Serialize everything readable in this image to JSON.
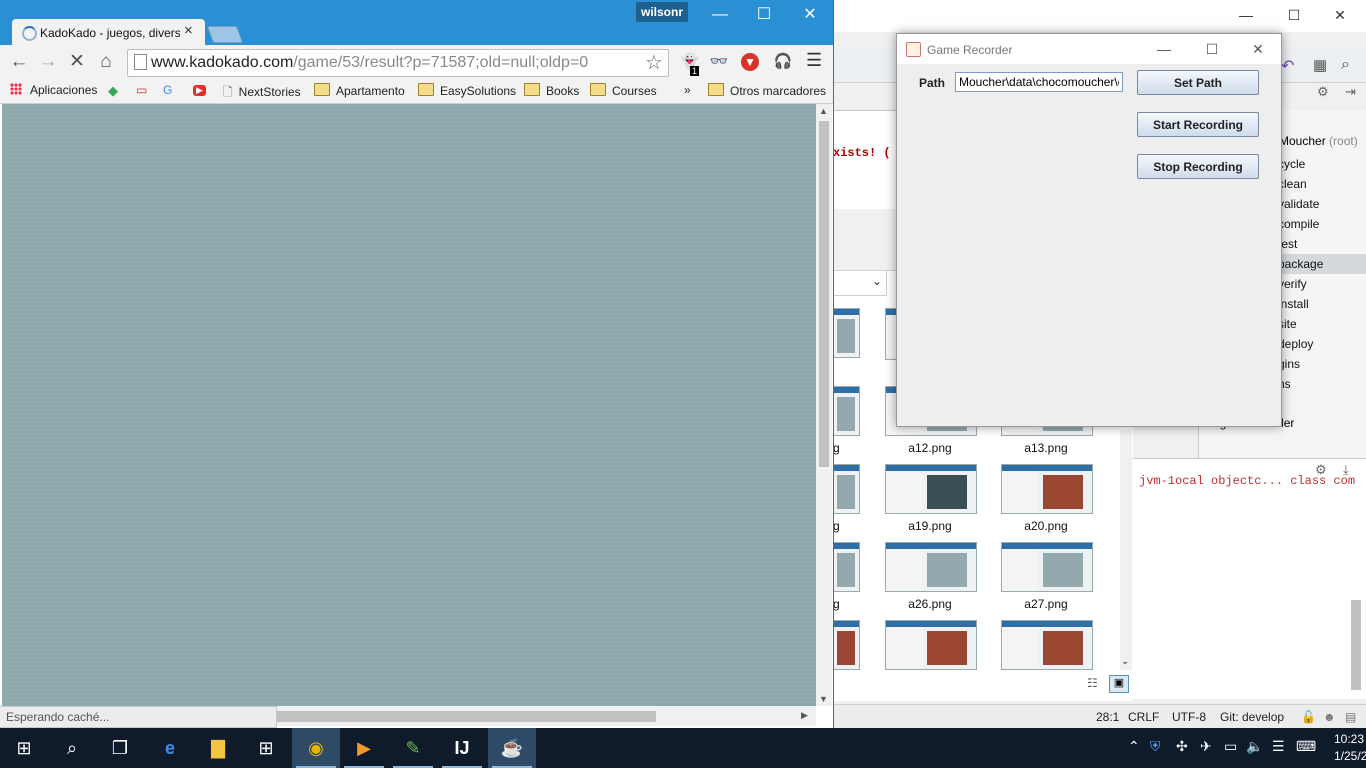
{
  "browser": {
    "user_badge": "wilsonr",
    "tab_title": "KadoKado - juegos, divers",
    "tab_close": "×",
    "url_host": "www.kadokado.com",
    "url_path": "/game/53/result?p=71587;old=null;oldp=0",
    "status_text": "Esperando caché...",
    "bookmarks": {
      "apps": "Aplicaciones",
      "items": [
        "NextStories",
        "Apartamento",
        "EasySolutions",
        "Books",
        "Courses"
      ],
      "overflow": "»",
      "other": "Otros marcadores"
    },
    "icons": {
      "back": "back-arrow-icon",
      "forward": "forward-arrow-icon",
      "stop": "stop-icon",
      "home": "home-icon",
      "star": "star-icon",
      "menu": "hamburger-menu-icon"
    },
    "extension_badge": "1",
    "page_bg_color": "#8ca8ab"
  },
  "recorder": {
    "title": "Game Recorder",
    "path_label": "Path",
    "path_value": "Moucher\\data\\chocomoucher\\e",
    "set_path": "Set Path",
    "start_recording": "Start Recording",
    "stop_recording": "Stop Recording"
  },
  "ide": {
    "console_text": "xists! (",
    "console_bottom_text": "jvm-1ocal objectc... class com",
    "maven_root": "Moucher",
    "maven_root_suffix": "(root)",
    "maven_items": [
      "cycle",
      "clean",
      "validate",
      "compile",
      "test",
      "package",
      "verify",
      "install",
      "site",
      "deploy",
      "gins",
      "ns"
    ],
    "maven_selected": "package",
    "module": "gamerecorder",
    "status": {
      "position": "28:1",
      "line_sep": "CRLF",
      "encoding": "UTF-8",
      "git": "Git: develop"
    }
  },
  "explorer": {
    "files": [
      {
        "name": "a12.png"
      },
      {
        "name": "a13.png"
      },
      {
        "name": "a19.png"
      },
      {
        "name": "a20.png"
      },
      {
        "name": "a26.png"
      },
      {
        "name": "a27.png"
      }
    ],
    "partial_label": "g"
  },
  "taskbar": {
    "time": "10:23",
    "date": "1/25/2"
  }
}
